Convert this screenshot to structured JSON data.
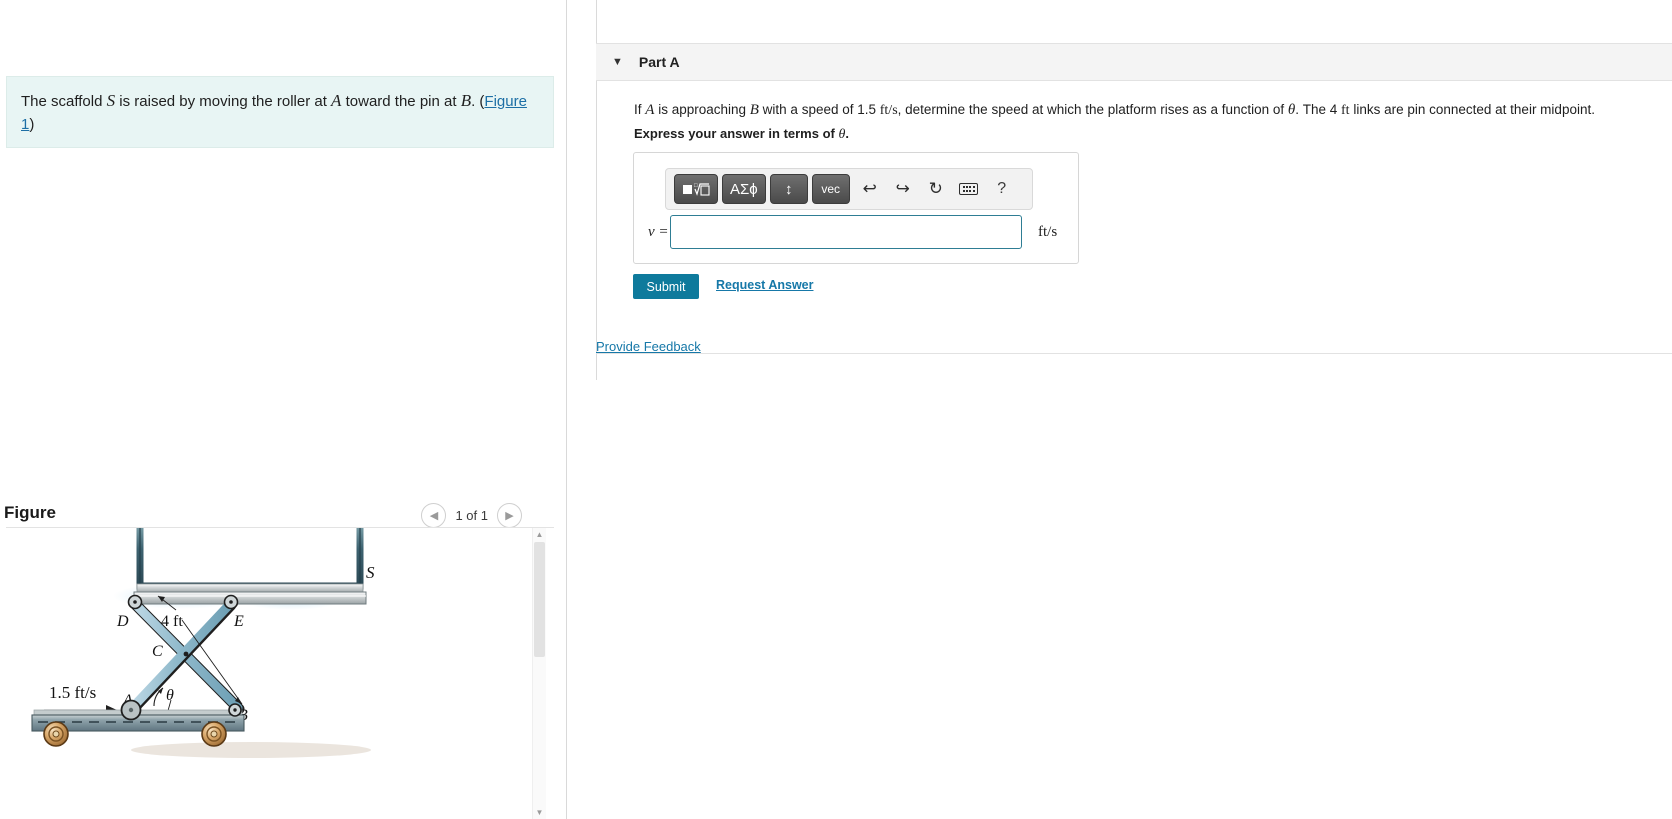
{
  "problem": {
    "statement_part1": "The scaffold ",
    "symbol_s": "S",
    "statement_part2": " is raised by moving the roller at ",
    "symbol_a": "A",
    "statement_part3": " toward the pin at ",
    "symbol_b": "B",
    "statement_part4": ". (",
    "figure_link": "Figure 1",
    "statement_part5": ")"
  },
  "figure_panel": {
    "title": "Figure",
    "counter": "1 of 1",
    "prev_icon": "chevron-left-icon",
    "next_icon": "chevron-right-icon"
  },
  "figure": {
    "label_s": "S",
    "label_d": "D",
    "label_e": "E",
    "label_c": "C",
    "label_a": "A",
    "label_b": "B",
    "label_theta": "θ",
    "length_label": "4 ft",
    "speed_label": "1.5 ft/s"
  },
  "part": {
    "caret_icon": "caret-down-icon",
    "label": "Part A",
    "q_if": "If ",
    "q_a": "A",
    "q_approaching": " is approaching ",
    "q_b": "B",
    "q_speed": " with a speed of 1.5 ",
    "q_ftps": "ft/s",
    "q_determine": ", determine the speed at which the platform rises as a function of ",
    "q_theta": "θ",
    "q_links1": ". The 4 ",
    "q_ft": "ft",
    "q_links2": " links are pin connected at their midpoint.",
    "instruction_pre": "Express your answer in terms of ",
    "instruction_theta": "θ",
    "instruction_post": "."
  },
  "answer": {
    "toolbar": {
      "template_label": "■√□",
      "template_name": "math-template-button",
      "greek_label": "ΑΣϕ",
      "arrows_label": "↕",
      "vec_label": "vec",
      "undo_icon": "undo-icon",
      "redo_icon": "redo-icon",
      "reset_icon": "reset-icon",
      "keyboard_icon": "keyboard-icon",
      "help_label": "?"
    },
    "variable": "v =",
    "value": "",
    "placeholder": "",
    "units": "ft/s",
    "submit_label": "Submit",
    "request_answer_label": "Request Answer"
  },
  "footer": {
    "provide_feedback": "Provide Feedback"
  },
  "colors": {
    "banner_bg": "#e8f5f4",
    "submit_bg": "#0e7a9c",
    "link": "#1678a8",
    "input_border": "#2e7d94"
  }
}
